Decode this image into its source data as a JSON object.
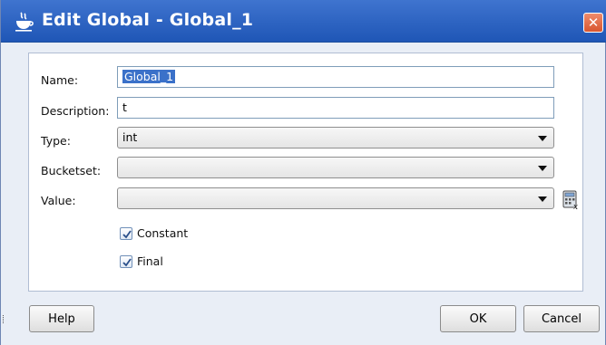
{
  "window": {
    "title": "Edit Global - Global_1",
    "close_label": "✕"
  },
  "form": {
    "name_label": "Name:",
    "name_value": "Global_1",
    "description_label": "Description:",
    "description_value": "t",
    "type_label": "Type:",
    "type_value": "int",
    "bucketset_label": "Bucketset:",
    "bucketset_value": "",
    "value_label": "Value:",
    "value_value": "",
    "constant_label": "Constant",
    "constant_checked": true,
    "final_label": "Final",
    "final_checked": true
  },
  "buttons": {
    "help": "Help",
    "ok": "OK",
    "cancel": "Cancel"
  },
  "colors": {
    "titlebar": "#2a62c3",
    "selection": "#3b71c9",
    "close": "#d8562f"
  }
}
